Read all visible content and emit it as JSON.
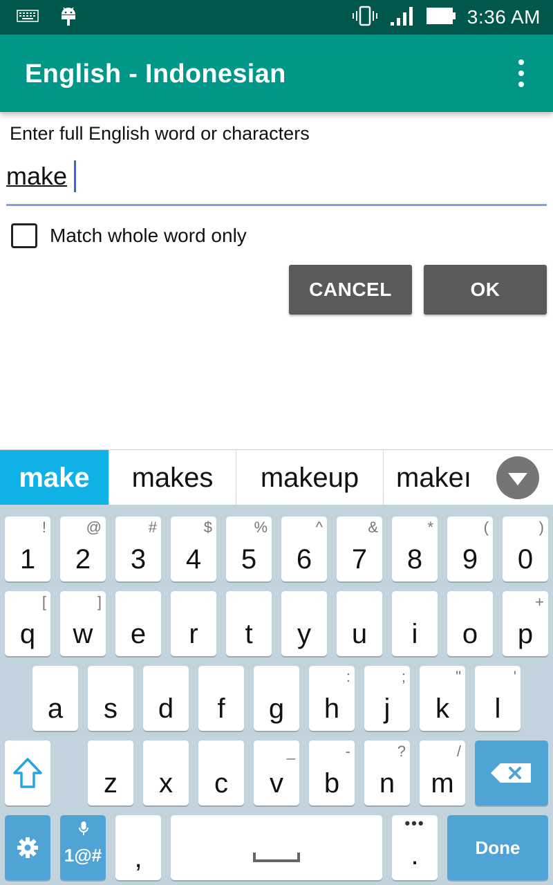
{
  "status_bar": {
    "time": "3:36 AM",
    "icons": [
      "keyboard-icon",
      "android-icon",
      "vibrate-icon",
      "signal-icon",
      "battery-icon"
    ]
  },
  "app_bar": {
    "title": "English - Indonesian",
    "overflow_icon": "more-vert-icon"
  },
  "search": {
    "prompt": "Enter full English word or characters",
    "value": "make",
    "match_whole_word_label": "Match whole word only",
    "match_whole_word_checked": false,
    "cancel_label": "CANCEL",
    "ok_label": "OK"
  },
  "suggestions": {
    "items": [
      "make",
      "makes",
      "makeup",
      "makeı"
    ],
    "selected_index": 0,
    "expand_icon": "expand-down-icon"
  },
  "keyboard": {
    "number_row": [
      {
        "main": "1",
        "alt": "!"
      },
      {
        "main": "2",
        "alt": "@"
      },
      {
        "main": "3",
        "alt": "#"
      },
      {
        "main": "4",
        "alt": "$"
      },
      {
        "main": "5",
        "alt": "%"
      },
      {
        "main": "6",
        "alt": "^"
      },
      {
        "main": "7",
        "alt": "&"
      },
      {
        "main": "8",
        "alt": "*"
      },
      {
        "main": "9",
        "alt": "("
      },
      {
        "main": "0",
        "alt": ")"
      }
    ],
    "top_row": [
      {
        "main": "q",
        "alt": "["
      },
      {
        "main": "w",
        "alt": "]"
      },
      {
        "main": "e",
        "alt": ""
      },
      {
        "main": "r",
        "alt": ""
      },
      {
        "main": "t",
        "alt": ""
      },
      {
        "main": "y",
        "alt": ""
      },
      {
        "main": "u",
        "alt": ""
      },
      {
        "main": "i",
        "alt": ""
      },
      {
        "main": "o",
        "alt": ""
      },
      {
        "main": "p",
        "alt": "+"
      }
    ],
    "home_row": [
      {
        "main": "a",
        "alt": ""
      },
      {
        "main": "s",
        "alt": ""
      },
      {
        "main": "d",
        "alt": ""
      },
      {
        "main": "f",
        "alt": ""
      },
      {
        "main": "g",
        "alt": ""
      },
      {
        "main": "h",
        "alt": ":"
      },
      {
        "main": "j",
        "alt": ";"
      },
      {
        "main": "k",
        "alt": "\""
      },
      {
        "main": "l",
        "alt": "'"
      }
    ],
    "bottom_row": [
      {
        "main": "z",
        "alt": ""
      },
      {
        "main": "x",
        "alt": ""
      },
      {
        "main": "c",
        "alt": ""
      },
      {
        "main": "v",
        "alt": "_"
      },
      {
        "main": "b",
        "alt": "-"
      },
      {
        "main": "n",
        "alt": "?"
      },
      {
        "main": "m",
        "alt": "/"
      }
    ],
    "shift_icon": "shift-icon",
    "backspace_icon": "backspace-icon",
    "settings_icon": "gear-icon",
    "symbols_label": "1@#",
    "mic_icon": "mic-icon",
    "comma_label": ",",
    "space_icon": "spacebar-icon",
    "period_label": ".",
    "period_alt": "•••",
    "done_label": "Done",
    "accent_color": "#4fa3d5",
    "background_color": "#c2d3de"
  },
  "colors": {
    "status_bar": "#00574b",
    "app_bar": "#009688",
    "suggestion_selected": "#0fb1e6",
    "button": "#5a5a5a",
    "input_underline": "#7e9fe8"
  }
}
